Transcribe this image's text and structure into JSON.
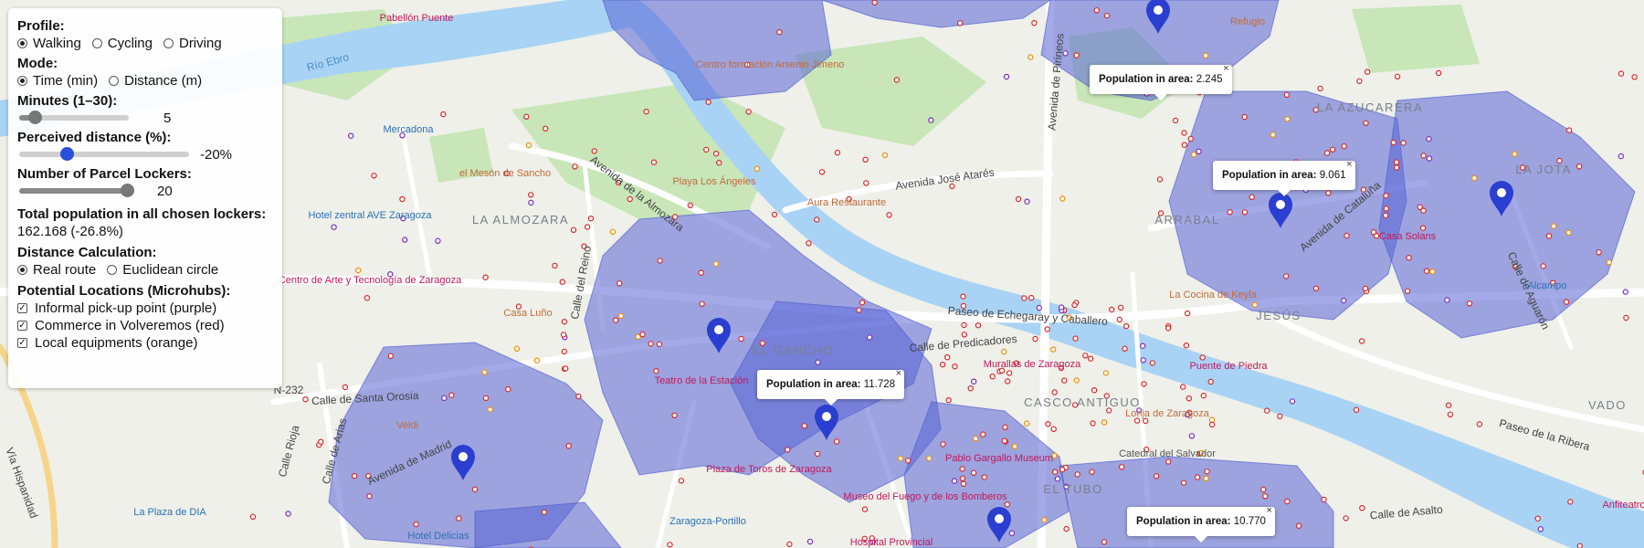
{
  "panel": {
    "profile_title": "Profile:",
    "profile_options": [
      "Walking",
      "Cycling",
      "Driving"
    ],
    "profile_selected": "Walking",
    "mode_title": "Mode:",
    "mode_options": [
      "Time (min)",
      "Distance (m)"
    ],
    "mode_selected": "Time (min)",
    "minutes_title": "Minutes (1–30):",
    "minutes_value": "5",
    "minutes_fraction": 0.14,
    "perceived_title": "Perceived distance (%):",
    "perceived_value": "-20%",
    "perceived_fraction": 0.28,
    "lockers_title": "Number of Parcel Lockers:",
    "lockers_value": "20",
    "lockers_fraction": 0.98,
    "total_title": "Total population in all chosen lockers:",
    "total_value": "162.168 (-26.8%)",
    "distance_title": "Distance Calculation:",
    "distance_options": [
      "Real route",
      "Euclidean circle"
    ],
    "distance_selected": "Real route",
    "locations_title": "Potential Locations (Microhubs):",
    "locations": [
      {
        "label": "Informal pick-up point (purple)",
        "checked": true
      },
      {
        "label": "Commerce in Volveremos (red)",
        "checked": true
      },
      {
        "label": "Local equipments (orange)",
        "checked": true
      }
    ]
  },
  "popups": [
    {
      "label": "Population in area:",
      "value": "2.245"
    },
    {
      "label": "Population in area:",
      "value": "9.061"
    },
    {
      "label": "Population in area:",
      "value": "11.728"
    },
    {
      "label": "Population in area:",
      "value": "10.770"
    }
  ],
  "map_labels": {
    "districts": [
      "LA ALMOZARA",
      "EL GANCHO",
      "ARRABAL",
      "JESÚS",
      "LA AZUCARERA",
      "LA JOTA",
      "CASCO ANTIGUO",
      "EL TUBO",
      "VADO"
    ],
    "streets": [
      "Avenida de la Almozara",
      "Avenida José Atarés",
      "Paseo de Echegaray y Caballero",
      "Calle de Predicadores",
      "Calle de Santa Orosia",
      "Avenida de Madrid",
      "Calle del Reino",
      "Calle Rioja",
      "Calle de Arias",
      "Vía Hispanidad",
      "Avenida de Pirineos",
      "Avenida de Cataluña",
      "Calle de Aguarón",
      "Paseo de la Ribera",
      "Calle de Asalto",
      "N-232",
      "Río Ebro"
    ],
    "pois": [
      "Pabellón Puente",
      "Centro formación Arsenio Jimeno",
      "Mercadona",
      "el Mesón de Sancho",
      "Playa Los Ángeles",
      "Aura Restaurante",
      "Hotel zentral AVE Zaragoza",
      "Centro de Arte y Tecnología de Zaragoza",
      "Casa Luño",
      "Teatro de la Estación",
      "Plaza de Toros de Zaragoza",
      "Museo del Fuego y de los Bomberos",
      "Pablo Gargallo Museum",
      "Murallas de Zaragoza",
      "Catedral del Salvador",
      "Lonja de Zaragoza",
      "Puente de Piedra",
      "Casa Solans",
      "La Cocina de Keyla",
      "Alcampo",
      "Refugio",
      "Zaragoza-Portillo",
      "Hospital Provincial",
      "La Plaza de DIA",
      "Hotel Delicias",
      "Veldi",
      "Anfiteatro"
    ]
  },
  "colors": {
    "isochrone_fill": "#5a64d6",
    "marker": "#2a3fcf",
    "river": "#a9d3f5",
    "park": "#c8e6b8",
    "dot_red": "#d9282b",
    "dot_purple": "#7b2cbf",
    "dot_orange": "#f08c00"
  }
}
